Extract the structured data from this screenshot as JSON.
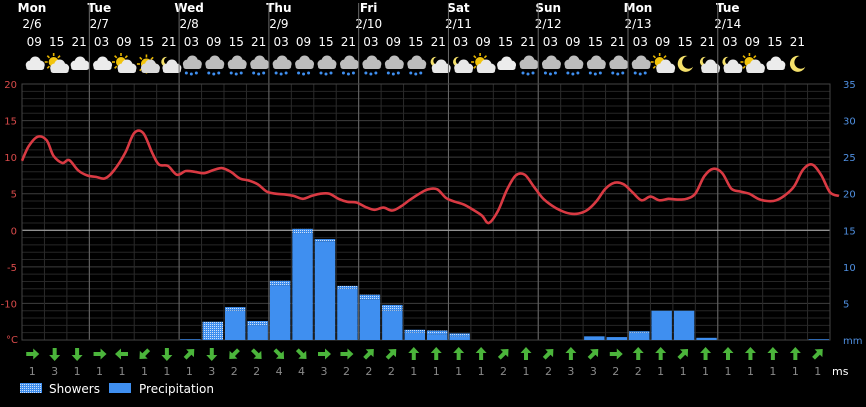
{
  "days": [
    {
      "name": "Mon",
      "date": "2/6"
    },
    {
      "name": "Tue",
      "date": "2/7"
    },
    {
      "name": "Wed",
      "date": "2/8"
    },
    {
      "name": "Thu",
      "date": "2/9"
    },
    {
      "name": "Fri",
      "date": "2/10"
    },
    {
      "name": "Sat",
      "date": "2/11"
    },
    {
      "name": "Sun",
      "date": "2/12"
    },
    {
      "name": "Mon",
      "date": "2/13"
    },
    {
      "name": "Tue",
      "date": "2/14"
    }
  ],
  "day_start_slots": [
    0,
    3,
    7,
    11,
    15,
    19,
    23,
    27,
    31
  ],
  "hours": [
    "09",
    "15",
    "21",
    "03",
    "09",
    "15",
    "21",
    "03",
    "09",
    "15",
    "21",
    "03",
    "09",
    "15",
    "21",
    "03",
    "09",
    "15",
    "21",
    "03",
    "09",
    "15",
    "21",
    "03",
    "09",
    "15",
    "21",
    "03",
    "09",
    "15",
    "21",
    "03",
    "09",
    "15",
    "21"
  ],
  "weather_icons": [
    "cloud-icon",
    "sun-cloud-icon",
    "cloud-icon",
    "cloud-icon",
    "sun-cloud-icon",
    "sun-icon",
    "moon-cloud-icon",
    "rain-cloud-icon",
    "rain-cloud-icon",
    "rain-cloud-icon",
    "rain-cloud-icon",
    "rain-cloud-icon",
    "rain-cloud-icon",
    "rain-cloud-icon",
    "rain-cloud-icon",
    "rain-cloud-icon",
    "rain-cloud-icon",
    "rain-cloud-icon",
    "moon-cloud-icon",
    "moon-cloud-icon",
    "sun-cloud-icon",
    "cloud-icon",
    "rain-cloud-icon",
    "rain-cloud-icon",
    "rain-cloud-icon",
    "rain-cloud-icon",
    "rain-cloud-icon",
    "rain-cloud-icon",
    "sun-cloud-icon",
    "moon-icon",
    "moon-cloud-icon",
    "moon-cloud-icon",
    "sun-cloud-icon",
    "cloud-icon",
    "moon-icon"
  ],
  "wind": {
    "directions": [
      "E",
      "S",
      "S",
      "E",
      "W",
      "SW",
      "S",
      "NE",
      "S",
      "SW",
      "SE",
      "SE",
      "SE",
      "E",
      "E",
      "NE",
      "NE",
      "N",
      "N",
      "N",
      "N",
      "NE",
      "N",
      "NE",
      "N",
      "NE",
      "E",
      "N",
      "N",
      "NE",
      "N",
      "N",
      "N",
      "N",
      "N",
      "NE"
    ],
    "speeds": [
      "1",
      "3",
      "1",
      "1",
      "1",
      "1",
      "1",
      "1",
      "3",
      "2",
      "2",
      "4",
      "4",
      "3",
      "2",
      "2",
      "2",
      "1",
      "1",
      "1",
      "1",
      "2",
      "1",
      "2",
      "3",
      "3",
      "2",
      "2",
      "1",
      "1",
      "1",
      "1",
      "1",
      "1",
      "1",
      "1"
    ],
    "unit": "ms"
  },
  "colors": {
    "temperature": "#d93a43",
    "precipitation": "#3f8ff0",
    "showers": "#a9c8ef",
    "wind_arrow": "#4bb53b",
    "grid": "#3a3a3a",
    "zero_line": "#b5b5b5"
  },
  "chart_data": {
    "type": "bar+line",
    "x": [
      "2/6 09",
      "2/6 15",
      "2/6 21",
      "2/7 03",
      "2/7 09",
      "2/7 15",
      "2/7 21",
      "2/8 03",
      "2/8 09",
      "2/8 15",
      "2/8 21",
      "2/9 03",
      "2/9 09",
      "2/9 15",
      "2/9 21",
      "2/10 03",
      "2/10 09",
      "2/10 15",
      "2/10 21",
      "2/11 03",
      "2/11 09",
      "2/11 15",
      "2/11 21",
      "2/12 03",
      "2/12 09",
      "2/12 15",
      "2/12 21",
      "2/13 03",
      "2/13 09",
      "2/13 15",
      "2/13 21",
      "2/14 03",
      "2/14 09",
      "2/14 15",
      "2/14 21"
    ],
    "left_axis": {
      "unit": "°C",
      "range": [
        -15,
        20
      ],
      "ticks": [
        20,
        15,
        10,
        5,
        0,
        -5,
        -10
      ]
    },
    "right_axis": {
      "unit": "mm",
      "range": [
        0,
        35
      ],
      "ticks": [
        35,
        30,
        25,
        20,
        15,
        10,
        5
      ]
    },
    "bar_slots": 36,
    "temperature": [
      [
        0,
        9.5
      ],
      [
        0.3,
        11.5
      ],
      [
        0.7,
        12.8
      ],
      [
        1.1,
        12.3
      ],
      [
        1.4,
        10.2
      ],
      [
        1.8,
        9.2
      ],
      [
        2.1,
        9.6
      ],
      [
        2.5,
        8.2
      ],
      [
        2.9,
        7.5
      ],
      [
        3.3,
        7.3
      ],
      [
        3.7,
        7.1
      ],
      [
        4.1,
        8.2
      ],
      [
        4.6,
        10.6
      ],
      [
        5.0,
        13.3
      ],
      [
        5.4,
        13.3
      ],
      [
        5.8,
        10.6
      ],
      [
        6.1,
        9.0
      ],
      [
        6.5,
        8.8
      ],
      [
        6.9,
        7.6
      ],
      [
        7.3,
        8.1
      ],
      [
        7.7,
        8.0
      ],
      [
        8.1,
        7.8
      ],
      [
        8.5,
        8.2
      ],
      [
        8.9,
        8.5
      ],
      [
        9.3,
        8.0
      ],
      [
        9.7,
        7.1
      ],
      [
        10.1,
        6.8
      ],
      [
        10.5,
        6.3
      ],
      [
        10.9,
        5.3
      ],
      [
        11.3,
        5.0
      ],
      [
        11.7,
        4.9
      ],
      [
        12.1,
        4.7
      ],
      [
        12.5,
        4.3
      ],
      [
        12.9,
        4.7
      ],
      [
        13.3,
        5.0
      ],
      [
        13.7,
        5.0
      ],
      [
        14.1,
        4.3
      ],
      [
        14.5,
        3.9
      ],
      [
        14.9,
        3.8
      ],
      [
        15.3,
        3.2
      ],
      [
        15.7,
        2.8
      ],
      [
        16.1,
        3.1
      ],
      [
        16.5,
        2.7
      ],
      [
        16.9,
        3.3
      ],
      [
        17.3,
        4.2
      ],
      [
        17.7,
        5.0
      ],
      [
        18.1,
        5.6
      ],
      [
        18.5,
        5.6
      ],
      [
        18.9,
        4.4
      ],
      [
        19.3,
        3.9
      ],
      [
        19.7,
        3.5
      ],
      [
        20.1,
        2.8
      ],
      [
        20.5,
        2.0
      ],
      [
        20.8,
        1.0
      ],
      [
        21.2,
        2.6
      ],
      [
        21.6,
        5.5
      ],
      [
        22.0,
        7.5
      ],
      [
        22.4,
        7.6
      ],
      [
        22.8,
        6.0
      ],
      [
        23.2,
        4.4
      ],
      [
        23.6,
        3.4
      ],
      [
        24.0,
        2.7
      ],
      [
        24.4,
        2.3
      ],
      [
        24.8,
        2.3
      ],
      [
        25.2,
        2.8
      ],
      [
        25.6,
        4.0
      ],
      [
        26.0,
        5.7
      ],
      [
        26.4,
        6.5
      ],
      [
        26.8,
        6.3
      ],
      [
        27.2,
        5.2
      ],
      [
        27.6,
        4.1
      ],
      [
        28.0,
        4.6
      ],
      [
        28.4,
        4.1
      ],
      [
        28.8,
        4.3
      ],
      [
        29.2,
        4.2
      ],
      [
        29.6,
        4.3
      ],
      [
        30.0,
        5.0
      ],
      [
        30.4,
        7.4
      ],
      [
        30.8,
        8.4
      ],
      [
        31.2,
        7.8
      ],
      [
        31.6,
        5.7
      ],
      [
        32.0,
        5.3
      ],
      [
        32.4,
        5.0
      ],
      [
        32.8,
        4.3
      ],
      [
        33.2,
        4.0
      ],
      [
        33.6,
        4.1
      ],
      [
        34.0,
        4.8
      ],
      [
        34.4,
        6.0
      ],
      [
        34.8,
        8.3
      ],
      [
        35.2,
        9.0
      ],
      [
        35.6,
        7.6
      ],
      [
        36.0,
        5.2
      ],
      [
        36.4,
        4.7
      ]
    ],
    "series": [
      {
        "name": "Precipitation",
        "values": [
          0,
          0,
          0,
          0,
          0,
          0,
          0,
          0,
          0,
          4,
          2,
          7.5,
          14.5,
          13.5,
          7,
          5.5,
          4,
          1,
          0.8,
          0.5,
          0,
          0,
          0,
          0,
          0,
          0.5,
          0.4,
          1,
          4,
          4,
          0.3,
          0,
          0,
          0,
          0,
          0
        ]
      },
      {
        "name": "Showers",
        "values": [
          0,
          0,
          0,
          0,
          0,
          0,
          0,
          0.1,
          2.5,
          0.5,
          0.6,
          0.6,
          0.7,
          0.3,
          0.4,
          0.7,
          0.8,
          0.4,
          0.5,
          0.4,
          0,
          0,
          0,
          0,
          0,
          0,
          0,
          0.2,
          0,
          0,
          0,
          0,
          0,
          0,
          0,
          0.1
        ]
      }
    ],
    "legend": [
      "Showers",
      "Precipitation"
    ],
    "legend_position": "bottom-left",
    "grid": true
  }
}
